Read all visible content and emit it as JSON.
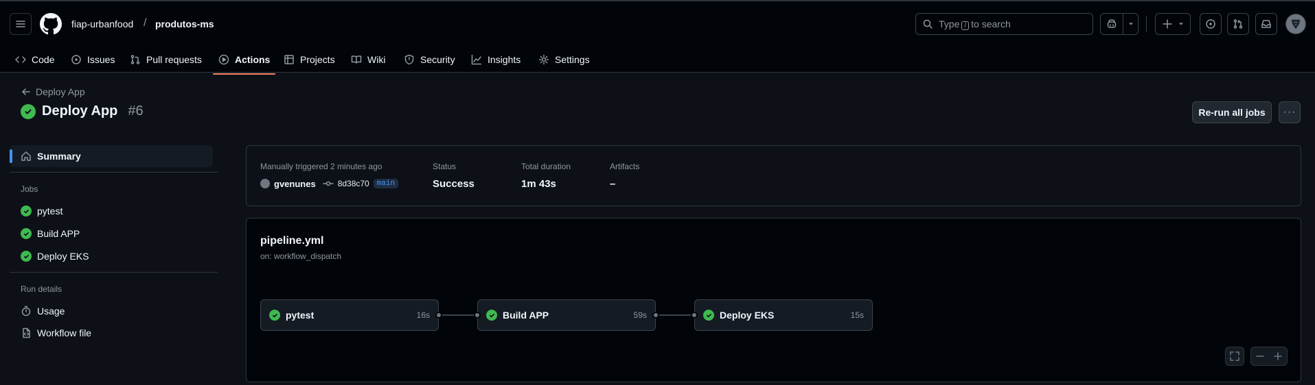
{
  "header": {
    "owner": "fiap-urbanfood",
    "separator": "/",
    "repo": "produtos-ms",
    "search": {
      "prefix": "Type",
      "key": "/",
      "suffix": "to search"
    }
  },
  "repo_nav": [
    {
      "label": "Code",
      "icon": "code-icon"
    },
    {
      "label": "Issues",
      "icon": "issue-icon"
    },
    {
      "label": "Pull requests",
      "icon": "pull-request-icon"
    },
    {
      "label": "Actions",
      "icon": "play-icon",
      "active": true
    },
    {
      "label": "Projects",
      "icon": "table-icon"
    },
    {
      "label": "Wiki",
      "icon": "book-icon"
    },
    {
      "label": "Security",
      "icon": "shield-icon"
    },
    {
      "label": "Insights",
      "icon": "graph-icon"
    },
    {
      "label": "Settings",
      "icon": "gear-icon"
    }
  ],
  "run": {
    "back_label": "Deploy App",
    "title": "Deploy App",
    "number": "#6",
    "rerun_label": "Re-run all jobs",
    "more_label": "···"
  },
  "sidebar": {
    "summary_label": "Summary",
    "jobs_heading": "Jobs",
    "jobs": [
      "pytest",
      "Build APP",
      "Deploy EKS"
    ],
    "run_details_heading": "Run details",
    "usage_label": "Usage",
    "workflow_file_label": "Workflow file"
  },
  "summary": {
    "trigger_label": "Manually triggered 2 minutes ago",
    "actor": "gvenunes",
    "commit": "8d38c70",
    "branch": "main",
    "status_label": "Status",
    "status_value": "Success",
    "duration_label": "Total duration",
    "duration_value": "1m 43s",
    "artifacts_label": "Artifacts",
    "artifacts_value": "–"
  },
  "pipeline": {
    "file": "pipeline.yml",
    "trigger": "on: workflow_dispatch",
    "jobs": [
      {
        "name": "pytest",
        "time": "16s"
      },
      {
        "name": "Build APP",
        "time": "59s"
      },
      {
        "name": "Deploy EKS",
        "time": "15s"
      }
    ]
  },
  "colors": {
    "success": "#3fb950",
    "accent": "#4493f8",
    "active_tab": "#f78166",
    "background": "#0d1117"
  }
}
